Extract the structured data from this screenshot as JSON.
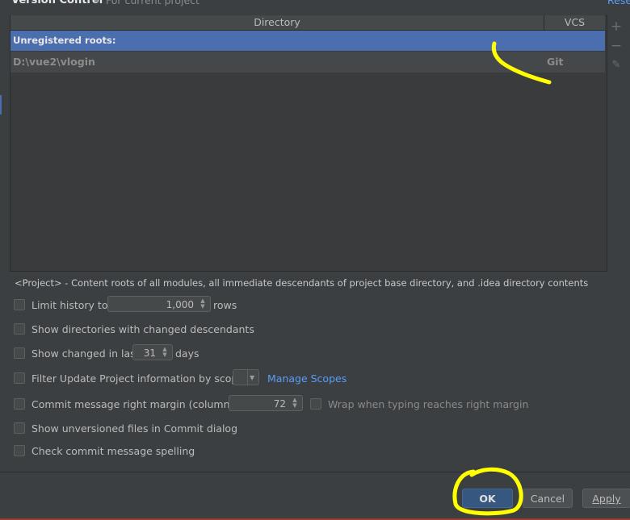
{
  "header": {
    "title": "Version Control",
    "subtitle": "For current project",
    "reset_link": "Rese"
  },
  "table": {
    "columns": [
      "Directory",
      "VCS"
    ],
    "group_label": "Unregistered roots:",
    "rows": [
      {
        "directory": "D:\\vue2\\vlogin",
        "vcs": "Git"
      }
    ]
  },
  "toolbar": {
    "add_icon": "+",
    "remove_icon": "−",
    "edit_icon": "✎"
  },
  "note": "<Project> - Content roots of all modules, all immediate descendants of project base directory, and .idea directory contents",
  "options": {
    "limit_history": {
      "label": "Limit history to:",
      "value": "1,000",
      "suffix": "rows"
    },
    "show_dirs_changed": {
      "label": "Show directories with changed descendants"
    },
    "show_changed_last": {
      "label": "Show changed in last",
      "value": "31",
      "suffix": "days"
    },
    "filter_update": {
      "label": "Filter Update Project information by scope",
      "link": "Manage Scopes"
    },
    "commit_margin": {
      "label": "Commit message right margin (columns):",
      "value": "72",
      "wrap_label": "Wrap when typing reaches right margin"
    },
    "show_unversioned": {
      "label": "Show unversioned files in Commit dialog"
    },
    "check_spelling": {
      "label": "Check commit message spelling"
    }
  },
  "buttons": {
    "ok": "OK",
    "cancel": "Cancel",
    "apply": "Apply"
  },
  "colors": {
    "annotation": "#ffff00",
    "selection": "#4b6eaf",
    "link": "#589df6"
  }
}
